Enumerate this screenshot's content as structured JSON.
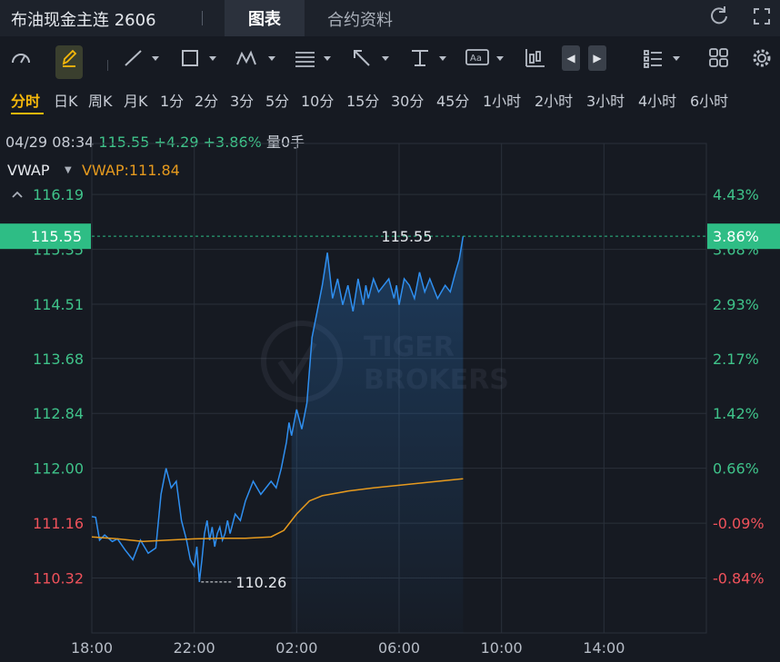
{
  "header": {
    "title": "布油现金主连 2606",
    "tabs": [
      {
        "label": "图表",
        "active": true
      },
      {
        "label": "合约资料",
        "active": false
      }
    ],
    "icons": [
      "refresh-icon",
      "fullscreen-icon"
    ]
  },
  "toolbar": {
    "icons": [
      "gauge-icon",
      "pencil-icon",
      "line-tool-icon",
      "rectangle-tool-icon",
      "pattern-tool-icon",
      "fibonacci-tool-icon",
      "arrow-tool-icon",
      "measure-tool-icon",
      "text-tool-icon",
      "candlestick-icon",
      "left-arrow-icon",
      "right-arrow-icon",
      "list-icon",
      "grid-icon",
      "settings-icon"
    ]
  },
  "timeframes": [
    "分时",
    "日K",
    "周K",
    "月K",
    "1分",
    "2分",
    "3分",
    "5分",
    "10分",
    "15分",
    "30分",
    "45分",
    "1小时",
    "2小时",
    "3小时",
    "4小时",
    "6小时"
  ],
  "active_timeframe": "分时",
  "quote": {
    "date": "04/29 08:34",
    "price": "115.55",
    "change": "+4.29",
    "pct": "+3.86%",
    "vol_label": "量",
    "vol": "0手"
  },
  "indicator": {
    "name": "VWAP",
    "value_label": "VWAP:111.84"
  },
  "colors": {
    "up": "#3fc38a",
    "down": "#f0525b",
    "line": "#2f8ff0",
    "vwap": "#e69a1e",
    "current_tag": "#2ebd85"
  },
  "chart_data": {
    "type": "line",
    "x_ticks": [
      "18:00",
      "22:00",
      "02:00",
      "06:00",
      "10:00",
      "14:00"
    ],
    "y_ticks": [
      "116.19",
      "115.35",
      "114.51",
      "113.68",
      "112.84",
      "112.00",
      "111.16",
      "110.32"
    ],
    "y_tick_values": [
      116.19,
      115.35,
      114.51,
      113.68,
      112.84,
      112.0,
      111.16,
      110.32
    ],
    "pct_ticks": [
      "4.43%",
      "3.68%",
      "2.93%",
      "2.17%",
      "1.42%",
      "0.66%",
      "-0.09%",
      "-0.84%"
    ],
    "ylim": [
      109.48,
      116.97
    ],
    "xlim_hours": [
      0,
      24
    ],
    "prev_close": 111.26,
    "current_price": "115.55",
    "current_pct": "3.86%",
    "max_label": "115.55",
    "min_label": "110.26",
    "series": [
      {
        "name": "price",
        "x": [
          0,
          0.15,
          0.3,
          0.5,
          0.8,
          1.0,
          1.3,
          1.6,
          1.9,
          2.2,
          2.5,
          2.7,
          2.9,
          3.1,
          3.3,
          3.5,
          3.7,
          3.85,
          4.0,
          4.1,
          4.2,
          4.3,
          4.4,
          4.5,
          4.6,
          4.7,
          4.8,
          4.9,
          5.0,
          5.1,
          5.2,
          5.3,
          5.4,
          5.6,
          5.8,
          6.0,
          6.3,
          6.6,
          7.0,
          7.2,
          7.4,
          7.6,
          7.7,
          7.8,
          8.0,
          8.2,
          8.4,
          8.6,
          8.8,
          9.0,
          9.2,
          9.4,
          9.6,
          9.8,
          10.0,
          10.2,
          10.4,
          10.5,
          10.6,
          10.7,
          10.8,
          11.0,
          11.2,
          11.4,
          11.6,
          11.8,
          11.9,
          12.0,
          12.2,
          12.4,
          12.6,
          12.8,
          13.0,
          13.2,
          13.5,
          13.8,
          14.0,
          14.2,
          14.35,
          14.5
        ],
        "y": [
          111.26,
          111.25,
          110.9,
          110.98,
          110.88,
          110.92,
          110.75,
          110.6,
          110.9,
          110.7,
          110.78,
          111.6,
          112.0,
          111.7,
          111.8,
          111.2,
          110.9,
          110.6,
          110.5,
          110.8,
          110.26,
          110.6,
          111.0,
          111.2,
          110.9,
          111.1,
          110.8,
          111.0,
          111.1,
          110.9,
          111.0,
          111.2,
          111.0,
          111.3,
          111.2,
          111.5,
          111.8,
          111.6,
          111.8,
          111.7,
          112.0,
          112.4,
          112.7,
          112.5,
          112.9,
          112.6,
          113.0,
          114.0,
          114.4,
          114.8,
          115.3,
          114.6,
          114.9,
          114.5,
          114.8,
          114.4,
          114.9,
          114.7,
          114.5,
          114.8,
          114.6,
          114.9,
          114.7,
          114.8,
          114.9,
          114.6,
          114.8,
          114.5,
          114.9,
          114.8,
          114.6,
          115.0,
          114.7,
          114.9,
          114.6,
          114.8,
          114.7,
          115.0,
          115.2,
          115.55
        ]
      },
      {
        "name": "VWAP",
        "x": [
          0,
          1,
          2,
          3,
          4,
          5,
          6,
          7,
          7.5,
          8,
          8.5,
          9,
          10,
          11,
          12,
          13,
          14,
          14.5
        ],
        "y": [
          110.95,
          110.92,
          110.88,
          110.9,
          110.92,
          110.93,
          110.93,
          110.95,
          111.05,
          111.3,
          111.5,
          111.58,
          111.65,
          111.7,
          111.74,
          111.78,
          111.82,
          111.84
        ]
      }
    ]
  }
}
